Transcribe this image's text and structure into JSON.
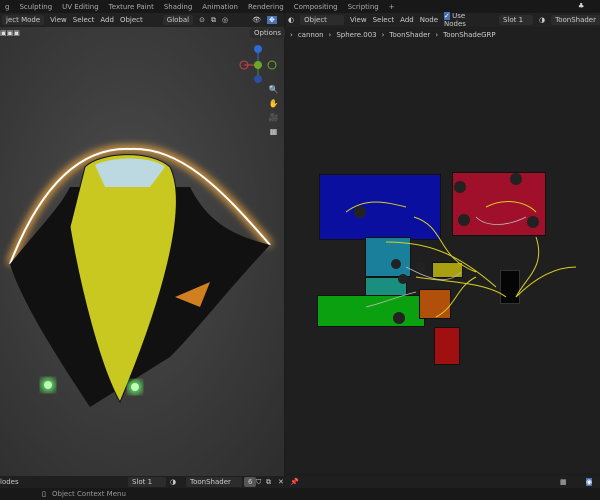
{
  "workspace_tabs": [
    "g",
    "Sculpting",
    "UV Editing",
    "Texture Paint",
    "Shading",
    "Animation",
    "Rendering",
    "Compositing",
    "Scripting",
    "+"
  ],
  "viewport": {
    "mode": "ject Mode",
    "menus": [
      "View",
      "Select",
      "Add",
      "Object"
    ],
    "orientation": "Global",
    "options": "Options"
  },
  "node_editor": {
    "object_type": "Object",
    "menus": [
      "View",
      "Select",
      "Add",
      "Node"
    ],
    "use_nodes": "Use Nodes",
    "slot": "Slot 1",
    "material": "ToonShader",
    "breadcrumb": [
      "cannon",
      "Sphere.003",
      "ToonShader",
      "ToonShadeGRP"
    ]
  },
  "footer": {
    "left_label": "lodes",
    "slot": "Slot 1",
    "material": "ToonShader",
    "users": "6"
  },
  "status": {
    "hint": "Object Context Menu"
  },
  "colors": {
    "blue": "#0a0fa0",
    "red": "#a0102a",
    "cyan": "#1a7f9a",
    "teal": "#1a8f80",
    "green": "#0aa010",
    "orange": "#b0500a",
    "yellow": "#a8a010",
    "darkred": "#a01010"
  }
}
